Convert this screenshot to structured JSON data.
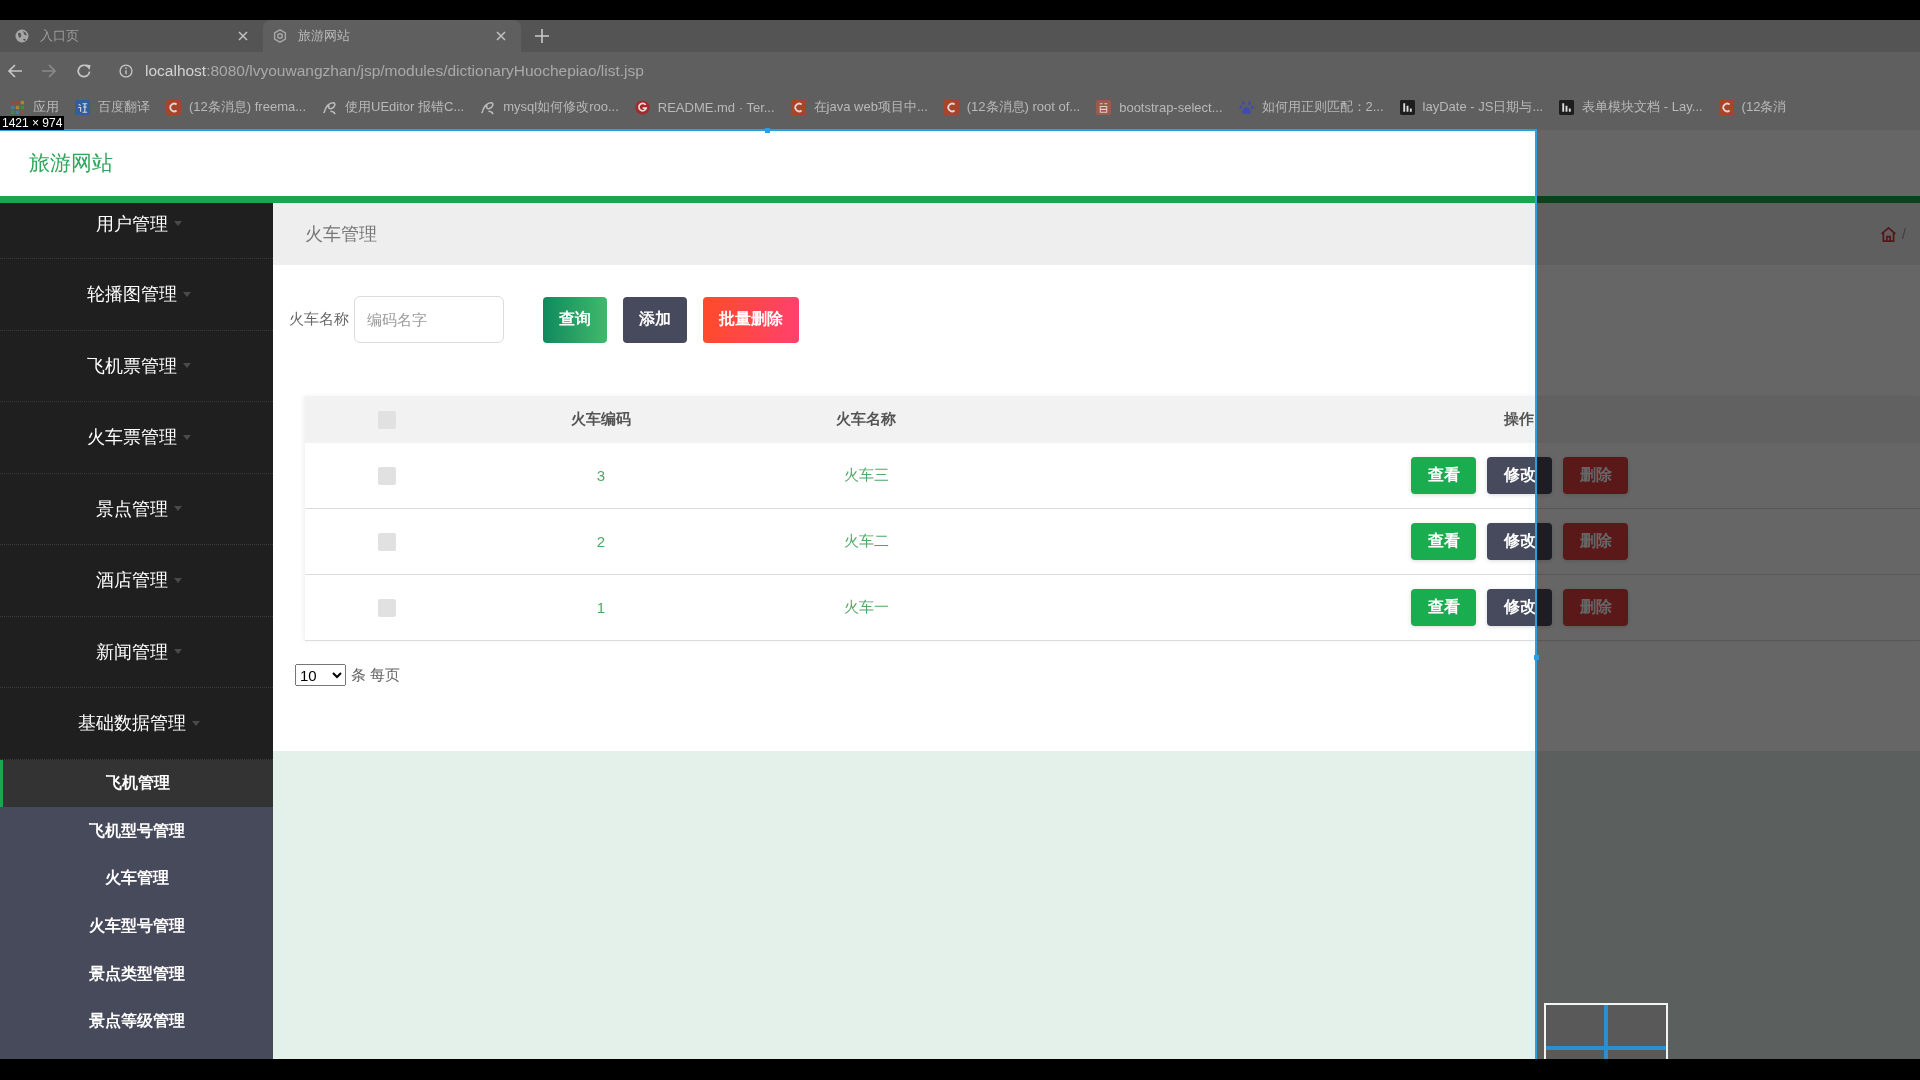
{
  "browser": {
    "tabs": [
      {
        "kind": "globe",
        "title": "入口页",
        "selected": false
      },
      {
        "kind": "site",
        "title": "旅游网站",
        "selected": true
      }
    ],
    "url": {
      "host": "localhost",
      "path": ":8080/lvyouwangzhan/jsp/modules/dictionaryHuochepiao/list.jsp"
    },
    "bookmarks": [
      {
        "kind": "apps",
        "label": "应用"
      },
      {
        "kind": "translate",
        "label": "百度翻译"
      },
      {
        "kind": "csdn",
        "label": "(12条消息) freema..."
      },
      {
        "kind": "swirl",
        "label": "使用UEditor 报错C..."
      },
      {
        "kind": "swirl",
        "label": "mysql如何修改roo..."
      },
      {
        "kind": "gitee",
        "label": "README.md · Ter..."
      },
      {
        "kind": "csdn",
        "label": "在java web项目中..."
      },
      {
        "kind": "csdn",
        "label": "(12条消息) root of..."
      },
      {
        "kind": "jian",
        "label": "bootstrap-select..."
      },
      {
        "kind": "paw",
        "label": "如何用正则匹配：2..."
      },
      {
        "kind": "layui",
        "label": "layDate - JS日期与..."
      },
      {
        "kind": "layui",
        "label": "表单模块文档 - Lay..."
      },
      {
        "kind": "csdn",
        "label": "(12条消"
      }
    ]
  },
  "devtools": {
    "viewport_size": "1421 × 974"
  },
  "site": {
    "title": "旅游网站"
  },
  "sidebar": {
    "items": [
      {
        "label": "用户管理"
      },
      {
        "label": "轮播图管理"
      },
      {
        "label": "飞机票管理"
      },
      {
        "label": "火车票管理"
      },
      {
        "label": "景点管理"
      },
      {
        "label": "酒店管理"
      },
      {
        "label": "新闻管理"
      },
      {
        "label": "基础数据管理",
        "children": [
          {
            "label": "飞机管理",
            "selected": true
          },
          {
            "label": "飞机型号管理",
            "selected": false
          },
          {
            "label": "火车管理",
            "selected": false
          },
          {
            "label": "火车型号管理",
            "selected": false
          },
          {
            "label": "景点类型管理",
            "selected": false
          },
          {
            "label": "景点等级管理",
            "selected": false
          }
        ]
      }
    ]
  },
  "page": {
    "title": "火车管理",
    "breadcrumb_separator": "/"
  },
  "search": {
    "label": "火车名称",
    "placeholder": "编码名字"
  },
  "toolbar_buttons": [
    {
      "kind": "search",
      "label": "查询"
    },
    {
      "kind": "add",
      "label": "添加"
    },
    {
      "kind": "batch_delete",
      "label": "批量删除"
    }
  ],
  "table": {
    "select_all": {
      "checked": false
    },
    "columns": [
      "火车编码",
      "火车名称",
      "操作"
    ],
    "rows": [
      {
        "checked": false,
        "code": "3",
        "name": "火车三",
        "actions": [
          {
            "kind": "view",
            "label": "查看"
          },
          {
            "kind": "edit",
            "label": "修改"
          },
          {
            "kind": "delete",
            "label": "删除"
          }
        ]
      },
      {
        "checked": false,
        "code": "2",
        "name": "火车二",
        "actions": [
          {
            "kind": "view",
            "label": "查看"
          },
          {
            "kind": "edit",
            "label": "修改"
          },
          {
            "kind": "delete",
            "label": "删除"
          }
        ]
      },
      {
        "checked": false,
        "code": "1",
        "name": "火车一",
        "actions": [
          {
            "kind": "view",
            "label": "查看"
          },
          {
            "kind": "edit",
            "label": "修改"
          },
          {
            "kind": "delete",
            "label": "删除"
          }
        ]
      }
    ]
  },
  "pagination": {
    "page_size": "10",
    "suffix": "条 每页"
  }
}
